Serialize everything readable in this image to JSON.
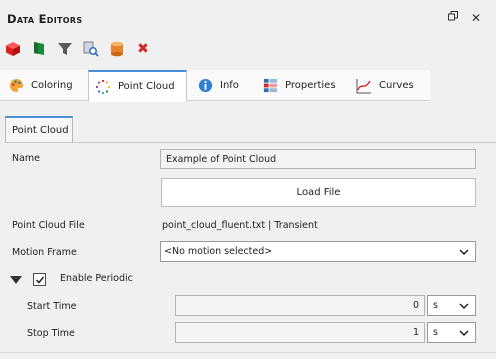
{
  "window": {
    "title": "Data Editors",
    "restore_icon": "restore-icon",
    "close_icon": "close-icon"
  },
  "toolbar": {
    "icons": [
      "red-cube-icon",
      "green-flag-icon",
      "funnel-icon",
      "search-document-icon",
      "database-icon",
      "delete-x-icon"
    ],
    "colors": {
      "cube": "#e02020",
      "flag": "#1a8a3a",
      "funnel": "#555555",
      "db": "#e8822a",
      "delete": "#d62828"
    }
  },
  "tabs": [
    {
      "label": "Coloring",
      "icon": "palette-icon"
    },
    {
      "label": "Point Cloud",
      "icon": "point-cloud-icon",
      "active": true
    },
    {
      "label": "Info",
      "icon": "info-icon"
    },
    {
      "label": "Properties",
      "icon": "properties-icon"
    },
    {
      "label": "Curves",
      "icon": "curves-icon"
    }
  ],
  "subtab": {
    "label": "Point Cloud"
  },
  "form": {
    "name_label": "Name",
    "name_value": "Example of Point Cloud",
    "load_button": "Load File",
    "file_label": "Point Cloud File",
    "file_value": "point_cloud_fluent.txt | Transient",
    "motion_label": "Motion Frame",
    "motion_value": "<No motion selected>",
    "periodic_label": "Enable Periodic",
    "periodic_checked": true,
    "start_label": "Start Time",
    "start_value": "0",
    "start_unit": "s",
    "stop_label": "Stop Time",
    "stop_value": "1",
    "stop_unit": "s"
  },
  "accent_color": "#4a90d9"
}
